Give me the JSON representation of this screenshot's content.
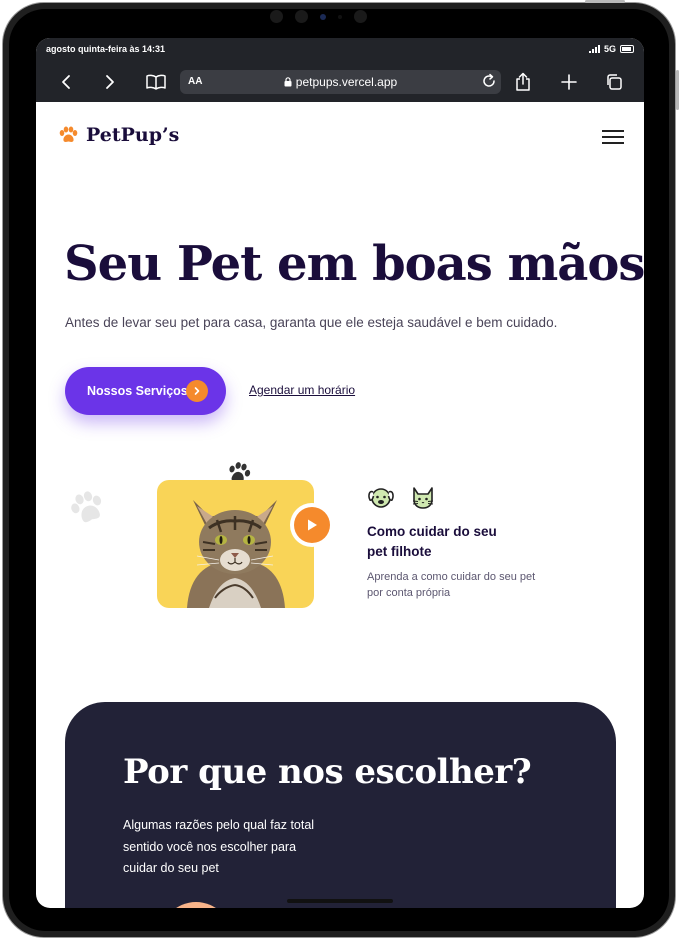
{
  "status_bar": {
    "time": "agosto quinta-feira às 14:31",
    "network": "5G"
  },
  "browser": {
    "url": "petpups.vercel.app",
    "reader_label": "AA"
  },
  "brand": {
    "name": "PetPup’s",
    "accent": "#f58a2c",
    "primary": "#6b34e8",
    "dark": "#1a0d3b"
  },
  "hero": {
    "title": "Seu Pet em boas mãos",
    "subtitle": "Antes de levar seu pet para casa, garanta que ele esteja saudável e bem cuidado.",
    "primary_button": "Nossos Serviços",
    "secondary_link": "Agendar um horário"
  },
  "video_card": {
    "title": "Como cuidar do seu pet filhote",
    "description": "Aprenda a como cuidar do seu pet por conta própria"
  },
  "why_section": {
    "title": "Por que nos escolher?",
    "text": "Algumas razões pelo qual faz total sentido você nos escolher para cuidar do seu pet"
  }
}
